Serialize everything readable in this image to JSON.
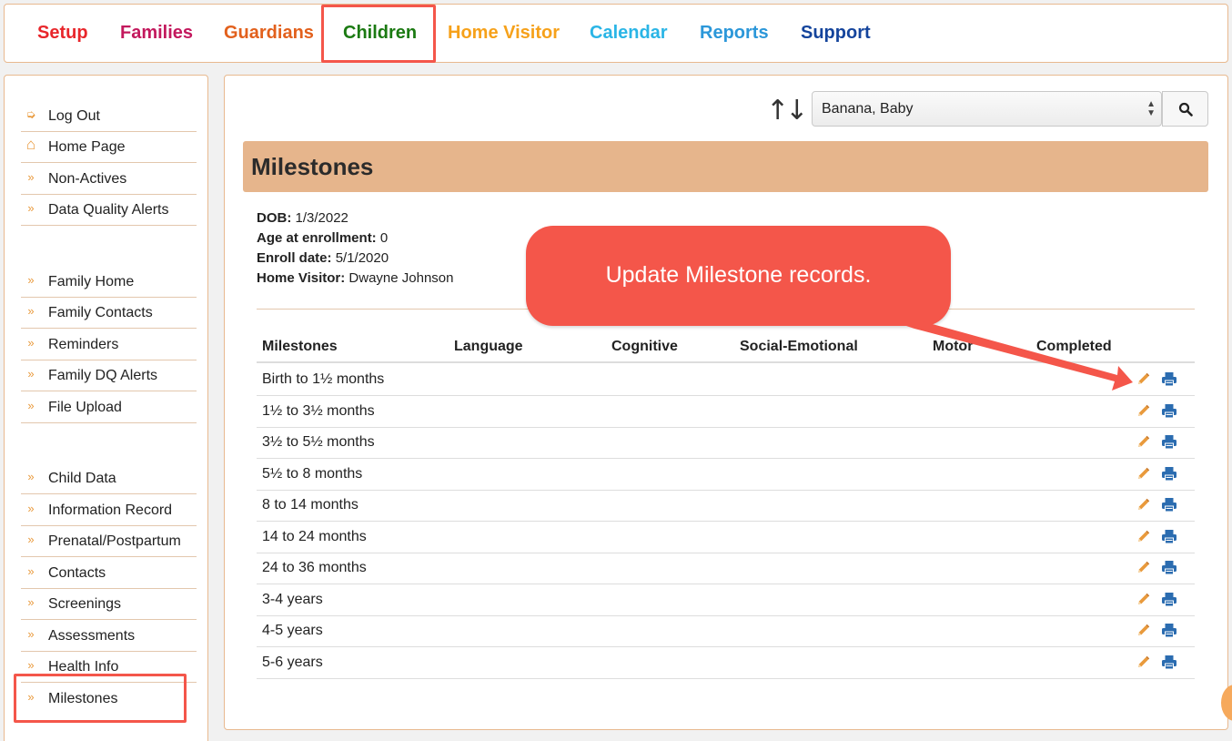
{
  "nav": {
    "items": [
      {
        "label": "Setup",
        "color": "#e8262b"
      },
      {
        "label": "Families",
        "color": "#c3185d"
      },
      {
        "label": "Guardians",
        "color": "#e2601c"
      },
      {
        "label": "Children",
        "color": "#1b7a12"
      },
      {
        "label": "Home Visitor",
        "color": "#f6a11a"
      },
      {
        "label": "Calendar",
        "color": "#2ab5e6"
      },
      {
        "label": "Reports",
        "color": "#2b97d9"
      },
      {
        "label": "Support",
        "color": "#14449c"
      }
    ],
    "active": "Children"
  },
  "sidebar": {
    "items": [
      {
        "label": "Log Out",
        "icon": "sign-out-icon"
      },
      {
        "label": "Home Page",
        "icon": "home-icon"
      },
      {
        "label": "Non-Actives",
        "icon": "double-chevron-icon"
      },
      {
        "label": "Data Quality Alerts",
        "icon": "double-chevron-icon"
      },
      {
        "label": "Family Home",
        "icon": "double-chevron-icon"
      },
      {
        "label": "Family Contacts",
        "icon": "double-chevron-icon"
      },
      {
        "label": "Reminders",
        "icon": "double-chevron-icon"
      },
      {
        "label": "Family DQ Alerts",
        "icon": "double-chevron-icon"
      },
      {
        "label": "File Upload",
        "icon": "double-chevron-icon"
      },
      {
        "label": "Child Data",
        "icon": "double-chevron-icon"
      },
      {
        "label": "Information Record",
        "icon": "double-chevron-icon"
      },
      {
        "label": "Prenatal/Postpartum",
        "icon": "double-chevron-icon"
      },
      {
        "label": "Contacts",
        "icon": "double-chevron-icon"
      },
      {
        "label": "Screenings",
        "icon": "double-chevron-icon"
      },
      {
        "label": "Assessments",
        "icon": "double-chevron-icon"
      },
      {
        "label": "Health Info",
        "icon": "double-chevron-icon"
      },
      {
        "label": "Milestones",
        "icon": "double-chevron-icon"
      }
    ],
    "active": "Milestones"
  },
  "child_select": {
    "value": "Banana, Baby"
  },
  "page_title": "Milestones",
  "info": {
    "dob_label": "DOB:",
    "dob": "1/3/2022",
    "age_label": "Age at enrollment:",
    "age": "0",
    "enroll_label": "Enroll date:",
    "enroll": "5/1/2020",
    "visitor_label": "Home Visitor:",
    "visitor": "Dwayne Johnson"
  },
  "table": {
    "headers": [
      "Milestones",
      "Language",
      "Cognitive",
      "Social-Emotional",
      "Motor",
      "Completed"
    ],
    "rows": [
      "Birth to 1½ months",
      "1½ to 3½ months",
      "3½ to 5½ months",
      "5½ to 8 months",
      "8 to 14 months",
      "14 to 24 months",
      "24 to 36 months",
      "3-4 years",
      "4-5 years",
      "5-6 years"
    ]
  },
  "callout": {
    "text": "Update Milestone records.",
    "color": "#f4564a"
  },
  "colors": {
    "accent": "#e99a3c",
    "border": "#e8b98f",
    "title_bg": "#e6b58c",
    "print_icon": "#2b6cb0"
  }
}
